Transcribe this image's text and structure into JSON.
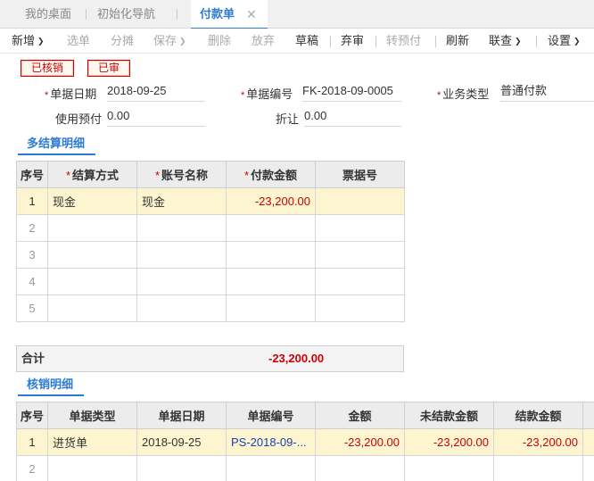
{
  "tabs": [
    {
      "label": "我的桌面"
    },
    {
      "label": "初始化导航"
    },
    {
      "label": "付款单",
      "close": "✕"
    }
  ],
  "toolbar": {
    "new": "新增",
    "select": "选单",
    "allocate": "分摊",
    "save": "保存",
    "delete": "删除",
    "discard": "放弃",
    "draft": "草稿",
    "unreview": "弃审",
    "to_prepay": "转预付",
    "refresh": "刷新",
    "query": "联查",
    "settings": "设置"
  },
  "stamps": {
    "verified": "已核销",
    "reviewed": "已审"
  },
  "form": {
    "doc_date_label": "单据日期",
    "doc_date": "2018-09-25",
    "doc_no_label": "单据编号",
    "doc_no": "FK-2018-09-0005",
    "biz_type_label": "业务类型",
    "biz_type": "普通付款",
    "use_prepay_label": "使用预付",
    "use_prepay": "0.00",
    "discount_label": "折让",
    "discount": "0.00"
  },
  "settle": {
    "title": "多结算明细",
    "headers": [
      "序号",
      "结算方式",
      "账号名称",
      "付款金额",
      "票据号"
    ],
    "rows": [
      {
        "no": "1",
        "method": "现金",
        "account": "现金",
        "amount": "-23,200.00",
        "bill": ""
      },
      {
        "no": "2",
        "method": "",
        "account": "",
        "amount": "",
        "bill": ""
      },
      {
        "no": "3",
        "method": "",
        "account": "",
        "amount": "",
        "bill": ""
      },
      {
        "no": "4",
        "method": "",
        "account": "",
        "amount": "",
        "bill": ""
      },
      {
        "no": "5",
        "method": "",
        "account": "",
        "amount": "",
        "bill": ""
      }
    ],
    "total_label": "合计",
    "total": "-23,200.00"
  },
  "verify": {
    "title": "核销明细",
    "headers": [
      "序号",
      "单据类型",
      "单据日期",
      "单据编号",
      "金额",
      "未结款金额",
      "结款金额"
    ],
    "rows": [
      {
        "no": "1",
        "type": "进货单",
        "date": "2018-09-25",
        "docno": "PS-2018-09-...",
        "amount": "-23,200.00",
        "unsettled": "-23,200.00",
        "settled": "-23,200.00"
      },
      {
        "no": "2",
        "type": "",
        "date": "",
        "docno": "",
        "amount": "",
        "unsettled": "",
        "settled": ""
      }
    ]
  },
  "colors": {
    "accent": "#2d7bd6",
    "negative": "#cc0000",
    "selected_row": "#fdf5d0",
    "link": "#1a3fb0"
  }
}
